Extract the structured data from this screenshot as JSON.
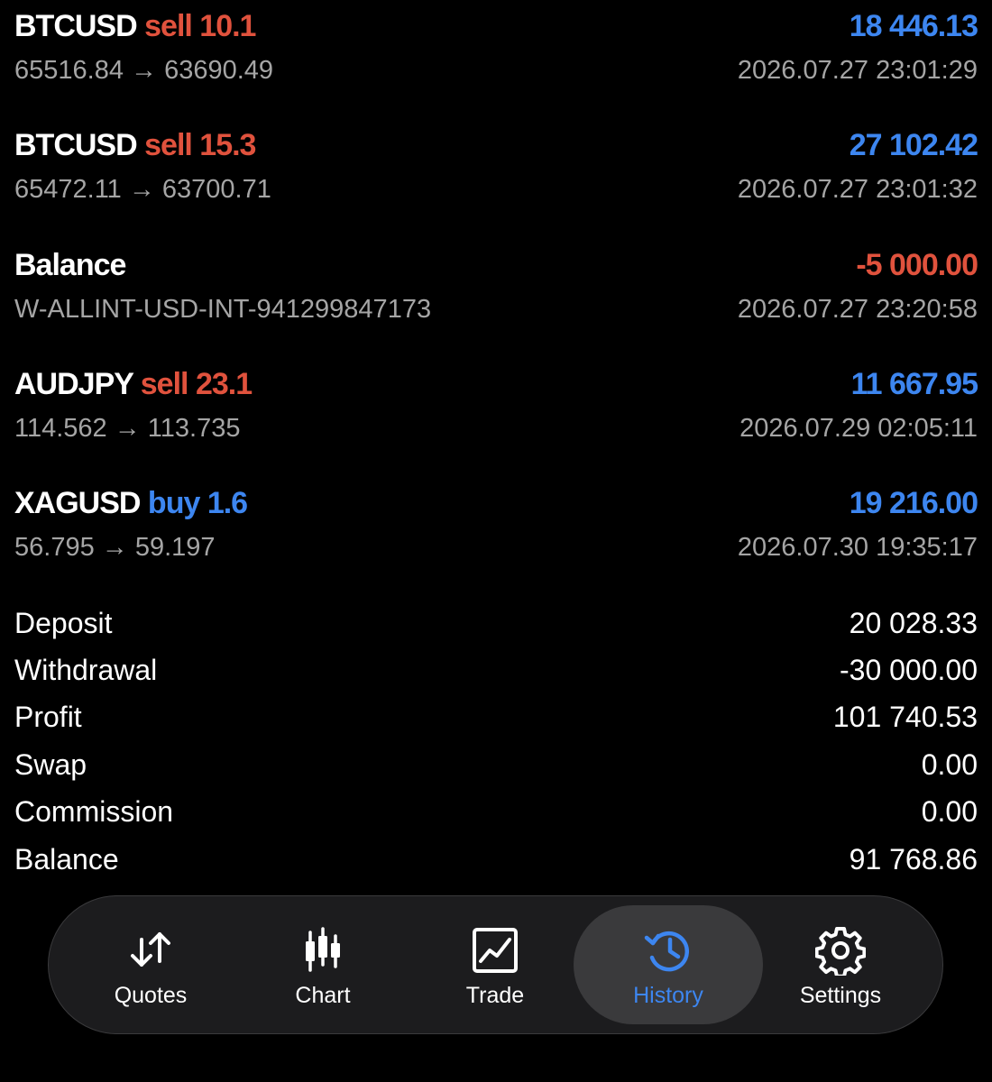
{
  "deals": [
    {
      "symbol": "BTCUSD",
      "side": "sell",
      "volume": "10.1",
      "profit": "18 446.13",
      "prices": "65516.84 → 63690.49",
      "time": "2026.07.27 23:01:29"
    },
    {
      "symbol": "BTCUSD",
      "side": "sell",
      "volume": "15.3",
      "profit": "27 102.42",
      "prices": "65472.11 → 63700.71",
      "time": "2026.07.27 23:01:32"
    },
    {
      "symbol": "Balance",
      "side": "",
      "volume": "",
      "profit": "-5 000.00",
      "prices": "W-ALLINT-USD-INT-941299847173",
      "time": "2026.07.27 23:20:58"
    },
    {
      "symbol": "AUDJPY",
      "side": "sell",
      "volume": "23.1",
      "profit": "11 667.95",
      "prices": "114.562 → 113.735",
      "time": "2026.07.29 02:05:11"
    },
    {
      "symbol": "XAGUSD",
      "side": "buy",
      "volume": "1.6",
      "profit": "19 216.00",
      "prices": "56.795 → 59.197",
      "time": "2026.07.30 19:35:17"
    }
  ],
  "summary": [
    {
      "label": "Deposit",
      "value": "20 028.33"
    },
    {
      "label": "Withdrawal",
      "value": "-30 000.00"
    },
    {
      "label": "Profit",
      "value": "101 740.53"
    },
    {
      "label": "Swap",
      "value": "0.00"
    },
    {
      "label": "Commission",
      "value": "0.00"
    },
    {
      "label": "Balance",
      "value": "91 768.86"
    }
  ],
  "tabs": [
    {
      "label": "Quotes",
      "icon": "quotes-arrows-icon",
      "active": false
    },
    {
      "label": "Chart",
      "icon": "candlestick-icon",
      "active": false
    },
    {
      "label": "Trade",
      "icon": "trade-chart-icon",
      "active": false
    },
    {
      "label": "History",
      "icon": "history-clock-icon",
      "active": true
    },
    {
      "label": "Settings",
      "icon": "gear-icon",
      "active": false
    }
  ],
  "colors": {
    "background": "#000000",
    "sell": "#e0523d",
    "buy": "#3d86f0",
    "positive": "#3d86f0",
    "negative": "#e0523d",
    "secondary_text": "#a5a5a5",
    "tabbar_bg": "#1c1c1e",
    "tab_active_bg": "#3a3a3c",
    "tab_active_text": "#3d86f0"
  }
}
